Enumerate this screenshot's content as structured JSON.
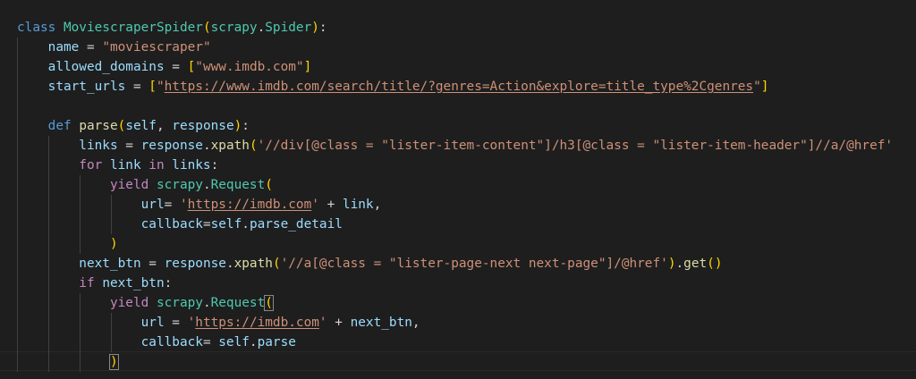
{
  "editor": {
    "language": "python",
    "lines": [
      {
        "id": "l1",
        "tokens": [
          {
            "t": "class ",
            "c": "kw"
          },
          {
            "t": "MoviescraperSpider",
            "c": "cls"
          },
          {
            "t": "(",
            "c": "p1"
          },
          {
            "t": "scrapy",
            "c": "cls"
          },
          {
            "t": ".",
            "c": "op"
          },
          {
            "t": "Spider",
            "c": "cls"
          },
          {
            "t": ")",
            "c": "p1"
          },
          {
            "t": ":",
            "c": "op"
          }
        ]
      },
      {
        "id": "l2",
        "tokens": [
          {
            "t": "    name",
            "c": "var"
          },
          {
            "t": " = ",
            "c": "op"
          },
          {
            "t": "\"moviescraper\"",
            "c": "str"
          }
        ]
      },
      {
        "id": "l3",
        "tokens": [
          {
            "t": "    allowed_domains",
            "c": "var"
          },
          {
            "t": " = ",
            "c": "op"
          },
          {
            "t": "[",
            "c": "p1"
          },
          {
            "t": "\"www.imdb.com\"",
            "c": "str"
          },
          {
            "t": "]",
            "c": "p1"
          }
        ]
      },
      {
        "id": "l4",
        "tokens": [
          {
            "t": "    start_urls",
            "c": "var"
          },
          {
            "t": " = ",
            "c": "op"
          },
          {
            "t": "[",
            "c": "p1"
          },
          {
            "t": "\"",
            "c": "str"
          },
          {
            "t": "https://www.imdb.com/search/title/?genres=Action&explore=title_type%2Cgenres",
            "c": "str url"
          },
          {
            "t": "\"",
            "c": "str"
          },
          {
            "t": "]",
            "c": "p1"
          }
        ]
      },
      {
        "id": "l5",
        "tokens": []
      },
      {
        "id": "l6",
        "tokens": [
          {
            "t": "    def ",
            "c": "kw"
          },
          {
            "t": "parse",
            "c": "fn"
          },
          {
            "t": "(",
            "c": "p1"
          },
          {
            "t": "self",
            "c": "var"
          },
          {
            "t": ", ",
            "c": "op"
          },
          {
            "t": "response",
            "c": "var"
          },
          {
            "t": ")",
            "c": "p1"
          },
          {
            "t": ":",
            "c": "op"
          }
        ]
      },
      {
        "id": "l7",
        "tokens": [
          {
            "t": "        links",
            "c": "var"
          },
          {
            "t": " = ",
            "c": "op"
          },
          {
            "t": "response",
            "c": "var"
          },
          {
            "t": ".",
            "c": "op"
          },
          {
            "t": "xpath",
            "c": "fn"
          },
          {
            "t": "(",
            "c": "p1"
          },
          {
            "t": "'//div[@class = \"lister-item-content\"]/h3[@class = \"lister-item-header\"]//a/@href'",
            "c": "str"
          }
        ]
      },
      {
        "id": "l8",
        "tokens": [
          {
            "t": "        for ",
            "c": "ctrl"
          },
          {
            "t": "link",
            "c": "var"
          },
          {
            "t": " in ",
            "c": "ctrl"
          },
          {
            "t": "links",
            "c": "var"
          },
          {
            "t": ":",
            "c": "op"
          }
        ]
      },
      {
        "id": "l9",
        "tokens": [
          {
            "t": "            yield ",
            "c": "ctrl"
          },
          {
            "t": "scrapy",
            "c": "cls"
          },
          {
            "t": ".",
            "c": "op"
          },
          {
            "t": "Request",
            "c": "cls"
          },
          {
            "t": "(",
            "c": "p1"
          }
        ]
      },
      {
        "id": "l10",
        "tokens": [
          {
            "t": "                url",
            "c": "var"
          },
          {
            "t": "= ",
            "c": "op"
          },
          {
            "t": "'",
            "c": "str"
          },
          {
            "t": "https://imdb.com",
            "c": "str url"
          },
          {
            "t": "'",
            "c": "str"
          },
          {
            "t": " + ",
            "c": "op"
          },
          {
            "t": "link",
            "c": "var"
          },
          {
            "t": ",",
            "c": "op"
          }
        ]
      },
      {
        "id": "l11",
        "tokens": [
          {
            "t": "                callback",
            "c": "var"
          },
          {
            "t": "=",
            "c": "op"
          },
          {
            "t": "self",
            "c": "var"
          },
          {
            "t": ".",
            "c": "op"
          },
          {
            "t": "parse_detail",
            "c": "var"
          }
        ]
      },
      {
        "id": "l12",
        "tokens": [
          {
            "t": "            ",
            "c": "op"
          },
          {
            "t": ")",
            "c": "p1"
          }
        ]
      },
      {
        "id": "l13",
        "tokens": [
          {
            "t": "        next_btn",
            "c": "var"
          },
          {
            "t": " = ",
            "c": "op"
          },
          {
            "t": "response",
            "c": "var"
          },
          {
            "t": ".",
            "c": "op"
          },
          {
            "t": "xpath",
            "c": "fn"
          },
          {
            "t": "(",
            "c": "p1"
          },
          {
            "t": "'//a[@class = \"lister-page-next next-page\"]/@href'",
            "c": "str"
          },
          {
            "t": ")",
            "c": "p1"
          },
          {
            "t": ".",
            "c": "op"
          },
          {
            "t": "get",
            "c": "fn"
          },
          {
            "t": "(",
            "c": "p1"
          },
          {
            "t": ")",
            "c": "p1"
          }
        ]
      },
      {
        "id": "l14",
        "tokens": [
          {
            "t": "        if ",
            "c": "ctrl"
          },
          {
            "t": "next_btn",
            "c": "var"
          },
          {
            "t": ":",
            "c": "op"
          }
        ]
      },
      {
        "id": "l15",
        "tokens": [
          {
            "t": "            yield ",
            "c": "ctrl"
          },
          {
            "t": "scrapy",
            "c": "cls"
          },
          {
            "t": ".",
            "c": "op"
          },
          {
            "t": "Request",
            "c": "cls"
          },
          {
            "t": "(",
            "c": "p1 bm"
          }
        ]
      },
      {
        "id": "l16",
        "tokens": [
          {
            "t": "                url",
            "c": "var"
          },
          {
            "t": " = ",
            "c": "op"
          },
          {
            "t": "'",
            "c": "str"
          },
          {
            "t": "https://imdb.com",
            "c": "str url"
          },
          {
            "t": "'",
            "c": "str"
          },
          {
            "t": " + ",
            "c": "op"
          },
          {
            "t": "next_btn",
            "c": "var"
          },
          {
            "t": ",",
            "c": "op"
          }
        ]
      },
      {
        "id": "l17",
        "tokens": [
          {
            "t": "                callback",
            "c": "var"
          },
          {
            "t": "= ",
            "c": "op"
          },
          {
            "t": "self",
            "c": "var"
          },
          {
            "t": ".",
            "c": "op"
          },
          {
            "t": "parse",
            "c": "var"
          }
        ]
      },
      {
        "id": "l18",
        "tokens": [
          {
            "t": "            ",
            "c": "op"
          },
          {
            "t": ")",
            "c": "p1 bm"
          }
        ]
      }
    ]
  }
}
